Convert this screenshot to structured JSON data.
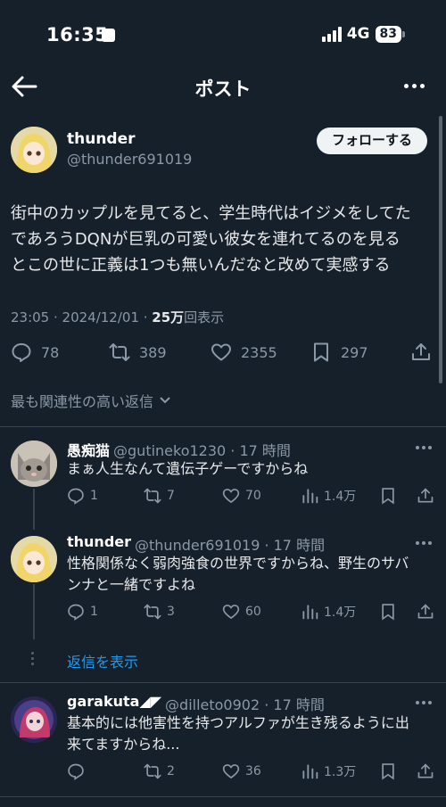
{
  "status_bar": {
    "time": "16:35",
    "network": "4G",
    "battery": "83"
  },
  "header": {
    "title": "ポスト"
  },
  "post": {
    "author_name": "thunder",
    "author_handle": "@thunder691019",
    "follow_label": "フォローする",
    "text_lines": [
      "街中のカップルを見てると、学生時代はイジメをしてた",
      "であろうDQNが巨乳の可愛い彼女を連れてるのを見る",
      "とこの世に正義は1つも無いんだなと改めて実感する"
    ],
    "timestamp": "23:05 · 2024/12/01 · ",
    "views": "25万",
    "views_suffix": "回表示",
    "replies": "78",
    "reposts": "389",
    "likes": "2355",
    "bookmarks": "297"
  },
  "sort_label": "最も関連性の高い返信",
  "replies": [
    {
      "name": "愚痴猫",
      "handle": "@gutineko1230 · 17 時間",
      "text_lines": [
        "まぁ人生なんて遺伝子ゲーですからね"
      ],
      "replies": "1",
      "reposts": "7",
      "likes": "70",
      "views": "1.4万"
    },
    {
      "name": "thunder",
      "handle": "@thunder691019 · 17 時間",
      "text_lines": [
        "性格関係なく弱肉強食の世界ですからね、野生のサバ",
        "ンナと一緒ですよね"
      ],
      "replies": "1",
      "reposts": "3",
      "likes": "60",
      "views": "1.4万"
    },
    {
      "name": "garakuta◢◤",
      "handle": "@dilleto0902 · 17 時間",
      "text_lines": [
        "基本的には他害性を持つアルファが生き残るように出",
        "来てますからね..."
      ],
      "replies": "",
      "reposts": "2",
      "likes": "36",
      "views": "1.3万"
    }
  ],
  "show_replies_label": "返信を表示",
  "colors": {
    "background": "#15202b",
    "accent": "#1d9bf0",
    "muted": "#8b98a5"
  }
}
